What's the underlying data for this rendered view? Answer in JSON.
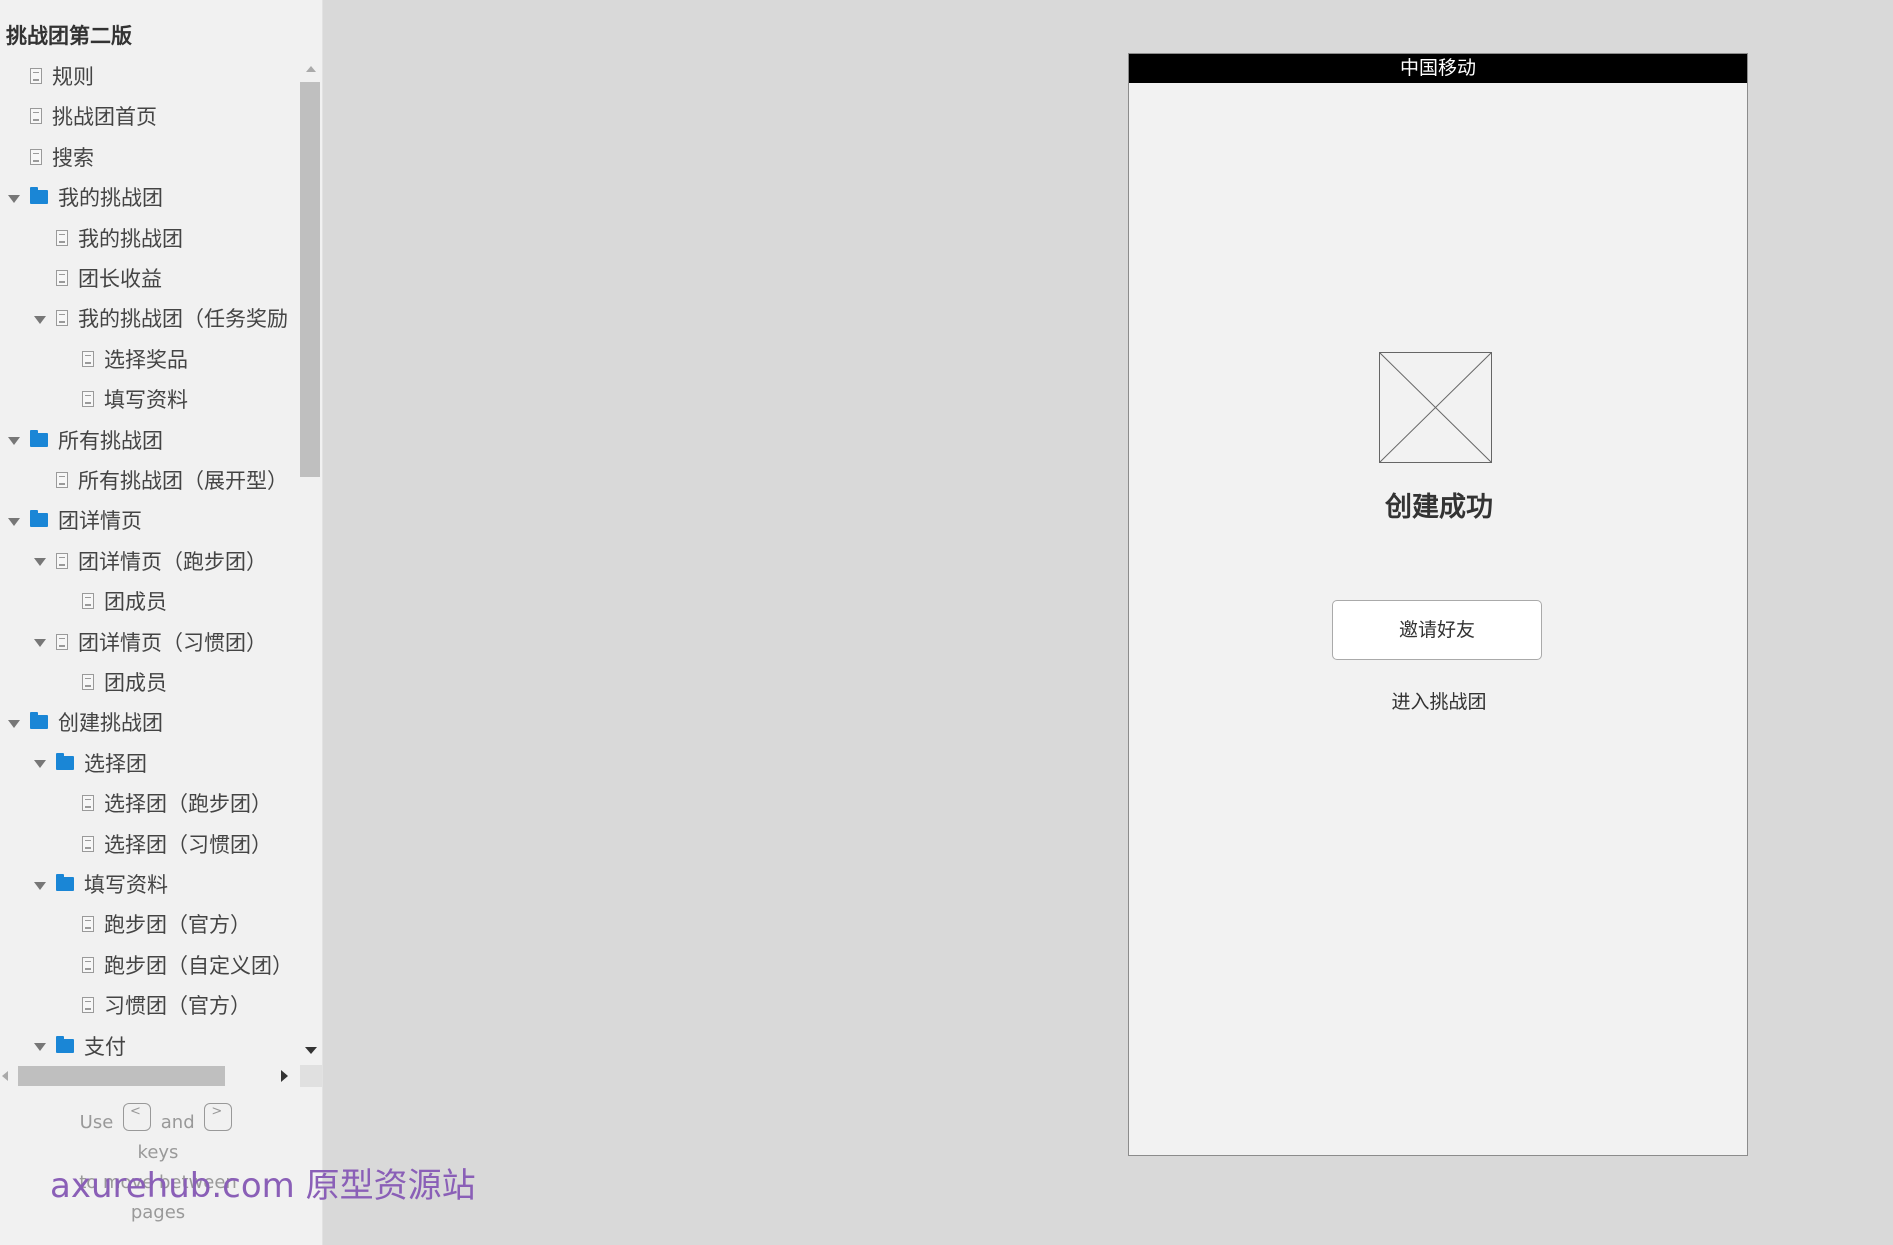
{
  "sidebar": {
    "title": "挑战团第二版",
    "items": [
      {
        "label": "规则",
        "type": "page",
        "level": 0,
        "expandable": false
      },
      {
        "label": "挑战团首页",
        "type": "page",
        "level": 0,
        "expandable": false
      },
      {
        "label": "搜索",
        "type": "page",
        "level": 0,
        "expandable": false
      },
      {
        "label": "我的挑战团",
        "type": "folder",
        "level": 0,
        "expandable": true
      },
      {
        "label": "我的挑战团",
        "type": "page",
        "level": 1,
        "expandable": false
      },
      {
        "label": "团长收益",
        "type": "page",
        "level": 1,
        "expandable": false
      },
      {
        "label": "我的挑战团（任务奖励",
        "type": "page",
        "level": 1,
        "expandable": true
      },
      {
        "label": "选择奖品",
        "type": "page",
        "level": 2,
        "expandable": false
      },
      {
        "label": "填写资料",
        "type": "page",
        "level": 2,
        "expandable": false
      },
      {
        "label": "所有挑战团",
        "type": "folder",
        "level": 0,
        "expandable": true
      },
      {
        "label": "所有挑战团（展开型）",
        "type": "page",
        "level": 1,
        "expandable": false
      },
      {
        "label": "团详情页",
        "type": "folder",
        "level": 0,
        "expandable": true
      },
      {
        "label": "团详情页（跑步团）",
        "type": "page",
        "level": 1,
        "expandable": true
      },
      {
        "label": "团成员",
        "type": "page",
        "level": 2,
        "expandable": false
      },
      {
        "label": "团详情页（习惯团）",
        "type": "page",
        "level": 1,
        "expandable": true
      },
      {
        "label": "团成员",
        "type": "page",
        "level": 2,
        "expandable": false
      },
      {
        "label": "创建挑战团",
        "type": "folder",
        "level": 0,
        "expandable": true
      },
      {
        "label": "选择团",
        "type": "folder",
        "level": 1,
        "expandable": true
      },
      {
        "label": "选择团（跑步团）",
        "type": "page",
        "level": 2,
        "expandable": false
      },
      {
        "label": "选择团（习惯团）",
        "type": "page",
        "level": 2,
        "expandable": false
      },
      {
        "label": "填写资料",
        "type": "folder",
        "level": 1,
        "expandable": true
      },
      {
        "label": "跑步团（官方）",
        "type": "page",
        "level": 2,
        "expandable": false
      },
      {
        "label": "跑步团（自定义团）",
        "type": "page",
        "level": 2,
        "expandable": false
      },
      {
        "label": "习惯团（官方）",
        "type": "page",
        "level": 2,
        "expandable": false
      },
      {
        "label": "支付",
        "type": "folder",
        "level": 1,
        "expandable": true
      }
    ]
  },
  "key_hint": {
    "use": "Use",
    "prev_key": "<",
    "and": "and",
    "next_key": ">",
    "keys": "keys",
    "to_move": "to move between",
    "pages": "pages"
  },
  "watermark": "axurehub.com 原型资源站",
  "phone": {
    "status_bar": "中国移动",
    "title": "创建成功",
    "invite_button": "邀请好友",
    "enter_link": "进入挑战团"
  },
  "icons": {
    "page": "page-icon",
    "folder": "folder-icon",
    "expand": "triangle-down-icon",
    "image_placeholder": "image-placeholder-icon"
  },
  "colors": {
    "folder": "#1a86d6",
    "canvas": "#d9d9d9",
    "watermark": "#8a5fb7"
  }
}
